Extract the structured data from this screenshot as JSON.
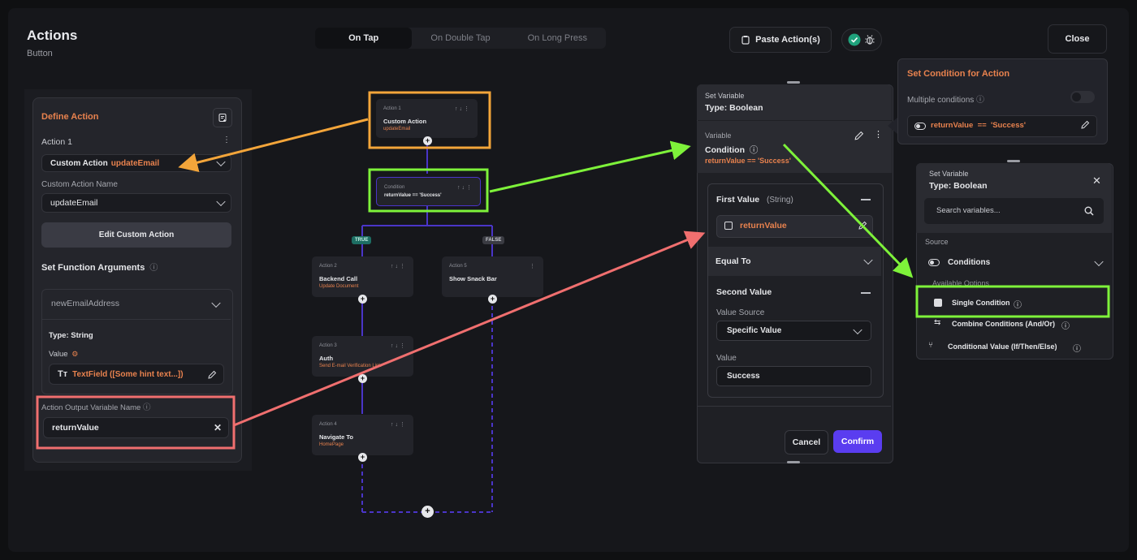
{
  "header": {
    "title": "Actions",
    "subtitle": "Button",
    "tabs": [
      {
        "label": "On Tap",
        "active": true
      },
      {
        "label": "On Double Tap",
        "active": false
      },
      {
        "label": "On Long Press",
        "active": false
      }
    ],
    "paste_label": "Paste Action(s)",
    "close_label": "Close"
  },
  "define_action": {
    "title": "Define Action",
    "action_label": "Action 1",
    "action_type": "Custom Action",
    "action_name": "updateEmail",
    "custom_action_name_label": "Custom Action Name",
    "custom_action_name_value": "updateEmail",
    "edit_button": "Edit Custom Action",
    "set_function_args_label": "Set Function Arguments",
    "argument_name": "newEmailAddress",
    "type_label": "Type: String",
    "value_label": "Value",
    "value_text": "TextField ([Some hint text...])",
    "output_var_label": "Action Output Variable Name",
    "output_var_value": "returnValue"
  },
  "flow": {
    "nodes": [
      {
        "small": "Action 1",
        "title": "Custom Action",
        "sub": "updateEmail"
      },
      {
        "small": "Condition",
        "title": "returnValue == 'Success'",
        "sub": ""
      },
      {
        "small": "Action 2",
        "title": "Backend Call",
        "sub": "Update Document"
      },
      {
        "small": "Action 5",
        "title": "Show Snack Bar",
        "sub": ""
      },
      {
        "small": "Action 3",
        "title": "Auth",
        "sub": "Send E-mail Verification Link"
      },
      {
        "small": "Action 4",
        "title": "Navigate To",
        "sub": "HomePage"
      }
    ],
    "true_label": "TRUE",
    "false_label": "FALSE"
  },
  "set_variable": {
    "heading_small": "Set Variable",
    "heading": "Type: Boolean",
    "variable_label": "Variable",
    "variable_name": "Condition",
    "variable_expr": "returnValue == 'Success'",
    "first_value_label": "First Value",
    "first_value_type": "(String)",
    "first_value": "returnValue",
    "equal_to_label": "Equal To",
    "second_value_label": "Second Value",
    "value_source_label": "Value Source",
    "value_source": "Specific Value",
    "value_label": "Value",
    "value": "Success",
    "cancel_label": "Cancel",
    "confirm_label": "Confirm"
  },
  "condition_panel": {
    "title": "Set Condition for Action",
    "multiple_label": "Multiple conditions",
    "cond_var": "returnValue",
    "cond_op": "==",
    "cond_val": "'Success'"
  },
  "set_variable_2": {
    "heading_small": "Set Variable",
    "heading": "Type: Boolean",
    "search_placeholder": "Search variables...",
    "source_label": "Source",
    "conditions_label": "Conditions",
    "available_label": "Available Options",
    "options": [
      "Single Condition",
      "Combine Conditions (And/Or)",
      "Conditional Value (If/Then/Else)"
    ]
  },
  "colors": {
    "orange_annotation": "#f3a53a",
    "green_annotation": "#7ef23a",
    "red_annotation": "#f06f6f",
    "accent_purple": "#5a3df0",
    "flow_line": "#4a35c8"
  }
}
